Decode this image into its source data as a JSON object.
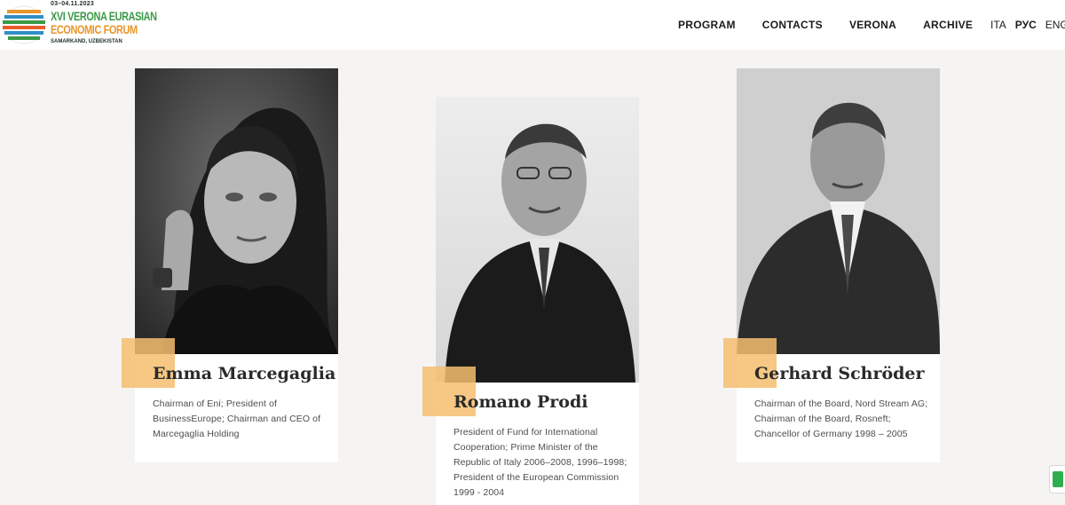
{
  "header": {
    "logo": {
      "date": "03–04.11.2023",
      "title_line1": "XVI VERONA EURASIAN",
      "title_line2": "ECONOMIC FORUM",
      "place": "SAMARKAND, UZBEKISTAN"
    },
    "nav": [
      "PROGRAM",
      "CONTACTS",
      "VERONA",
      "ARCHIVE"
    ],
    "languages": [
      {
        "label": "ITA",
        "active": false
      },
      {
        "label": "РУС",
        "active": true
      },
      {
        "label": "ENG",
        "active": false
      }
    ]
  },
  "speakers": [
    {
      "name": "Emma Marcegaglia",
      "description": "Chairman of Eni; President of BusinessEurope; Chairman and CEO of Marcegaglia Holding"
    },
    {
      "name": "Romano Prodi",
      "description": "President of Fund for International Cooperation; Prime Minister of the Republic of Italy 2006–2008, 1996–1998; President of the European Commission 1999 - 2004"
    },
    {
      "name": "Gerhard Schröder",
      "description": "Chairman of the Board, Nord Stream AG; Chairman of the Board, Rosneft; Chancellor of Germany 1998 – 2005"
    }
  ],
  "colors": {
    "accent_orange": "#f5be6e",
    "logo_green": "#3a9a47",
    "logo_orange": "#e8962a",
    "background": "#f5f4f3"
  }
}
